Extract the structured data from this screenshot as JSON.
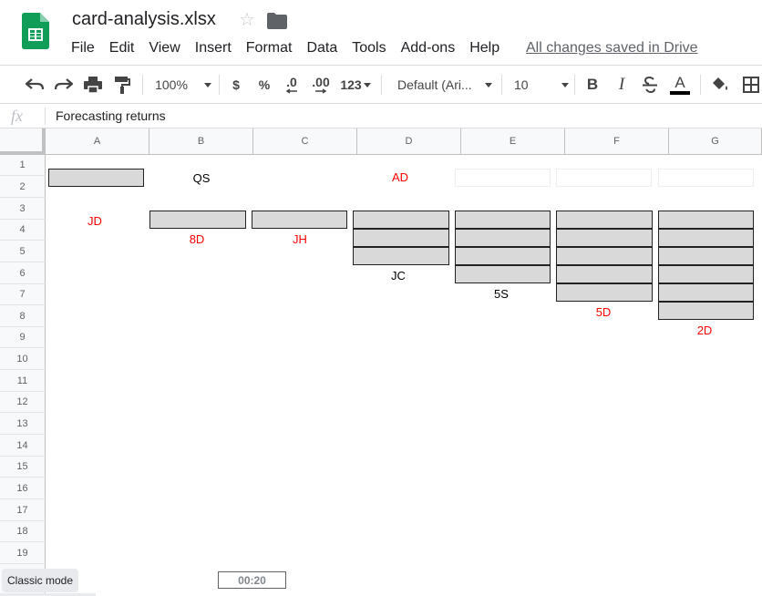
{
  "header": {
    "title": "card-analysis.xlsx",
    "save_status": "All changes saved in Drive",
    "icons": [
      "sheets-logo-icon",
      "star-icon",
      "folder-icon"
    ]
  },
  "menu": [
    "File",
    "Edit",
    "View",
    "Insert",
    "Format",
    "Data",
    "Tools",
    "Add-ons",
    "Help"
  ],
  "toolbar": {
    "zoom": "100%",
    "currency": "$",
    "percent": "%",
    "decrease_decimal": ".0",
    "increase_decimal": ".00",
    "more_formats": "123",
    "font": "Default (Ari...",
    "font_size": "10",
    "bold": "B",
    "italic": "I",
    "text_color_letter": "A"
  },
  "formula_bar": {
    "fx": "fx",
    "value": "Forecasting returns"
  },
  "grid": {
    "columns": [
      "A",
      "B",
      "C",
      "D",
      "E",
      "F",
      "G"
    ],
    "rows": [
      "1",
      "2",
      "3",
      "4",
      "5",
      "6",
      "7",
      "8",
      "9",
      "10",
      "11",
      "12",
      "13",
      "14",
      "15",
      "16",
      "17",
      "18",
      "19"
    ]
  },
  "cards": {
    "stock_label": "",
    "waste": "QS",
    "foundation_1": "AD",
    "pile_1": "JD",
    "pile_2": "8D",
    "pile_3": "JH",
    "pile_4": "JC",
    "pile_5": "5S",
    "pile_6": "5D",
    "pile_7": "2D"
  },
  "colors": {
    "red_card": "#ff0000",
    "black_card": "#000000",
    "card_back": "#d9d9d9",
    "sheets_green": "#0f9d58"
  },
  "footer": {
    "classic_mode": "Classic mode",
    "timer": "00:20"
  }
}
